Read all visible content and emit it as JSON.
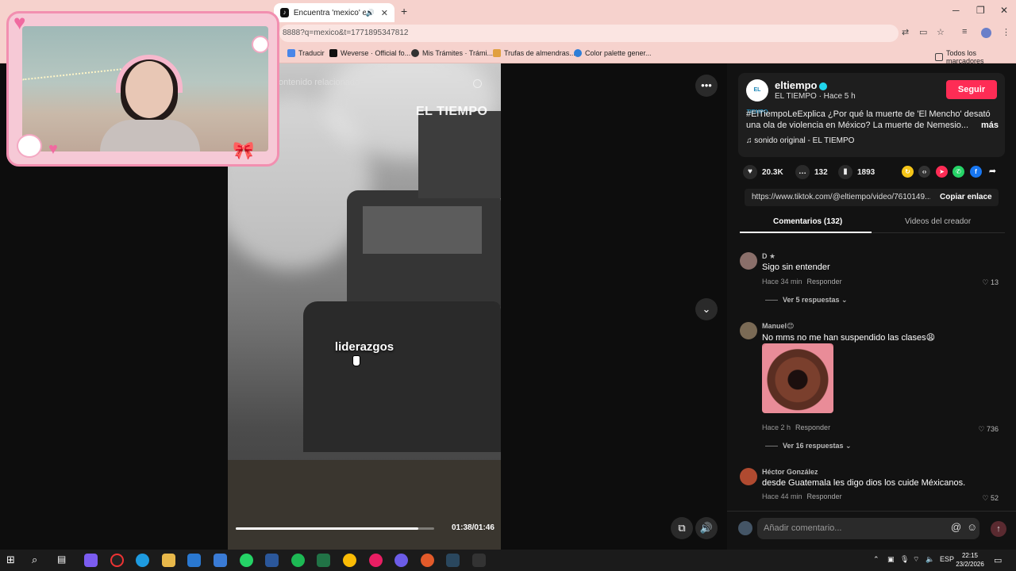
{
  "browser": {
    "tab_title": "Encuentra 'mexico' en TikTo",
    "url": "8888?q=mexico&t=1771895347812",
    "bookmarks": [
      "Traducir",
      "Weverse · Official fo...",
      "Mis Trámites · Trámi...",
      "Trufas de almendras...",
      "Color palette gener..."
    ],
    "all_bookmarks": "Todos los marcadores"
  },
  "video": {
    "search_placeholder": "ontenido relacionado",
    "watermark": "EL TIEMPO",
    "caption": "liderazgos",
    "timecode": "01:38/01:46",
    "progress": 0.92
  },
  "post": {
    "username": "eltiempo",
    "meta": "EL TIEMPO · Hace 5 h",
    "follow_label": "Seguir",
    "avatar_text": "EL TIEMPO",
    "description": "#ElTiempoLeExplica ¿Por qué la muerte de 'El Mencho' desató una ola de violencia en México? La muerte de Nemesio...",
    "more_label": "más",
    "sound": "♫  sonido original - EL TIEMPO",
    "likes": "20.3K",
    "comments": "132",
    "saves": "1893",
    "link": "https://www.tiktok.com/@eltiempo/video/7610149...",
    "copy_link": "Copiar enlace"
  },
  "tabs": {
    "comments": "Comentarios (132)",
    "creator_videos": "Videos del creador"
  },
  "comments": [
    {
      "name": "D ★",
      "text": "Sigo sin entender",
      "time": "Hace 34 min",
      "reply": "Responder",
      "likes": "13",
      "replies": "Ver 5 respuestas ⌄"
    },
    {
      "name": "Manuel😊",
      "text": "No mms no me han suspendido las clases😩",
      "time": "Hace 2 h",
      "reply": "Responder",
      "likes": "736",
      "replies": "Ver 16 respuestas ⌄"
    },
    {
      "name": "Héctor González",
      "text": "desde Guatemala les digo dios los cuide Méxicanos.",
      "time": "Hace 44 min",
      "reply": "Responder",
      "likes": "52"
    }
  ],
  "comment_box": {
    "placeholder": "Añadir comentario..."
  },
  "taskbar": {
    "lang": "ESP",
    "time": "22:15",
    "date": "23/2/2026"
  }
}
